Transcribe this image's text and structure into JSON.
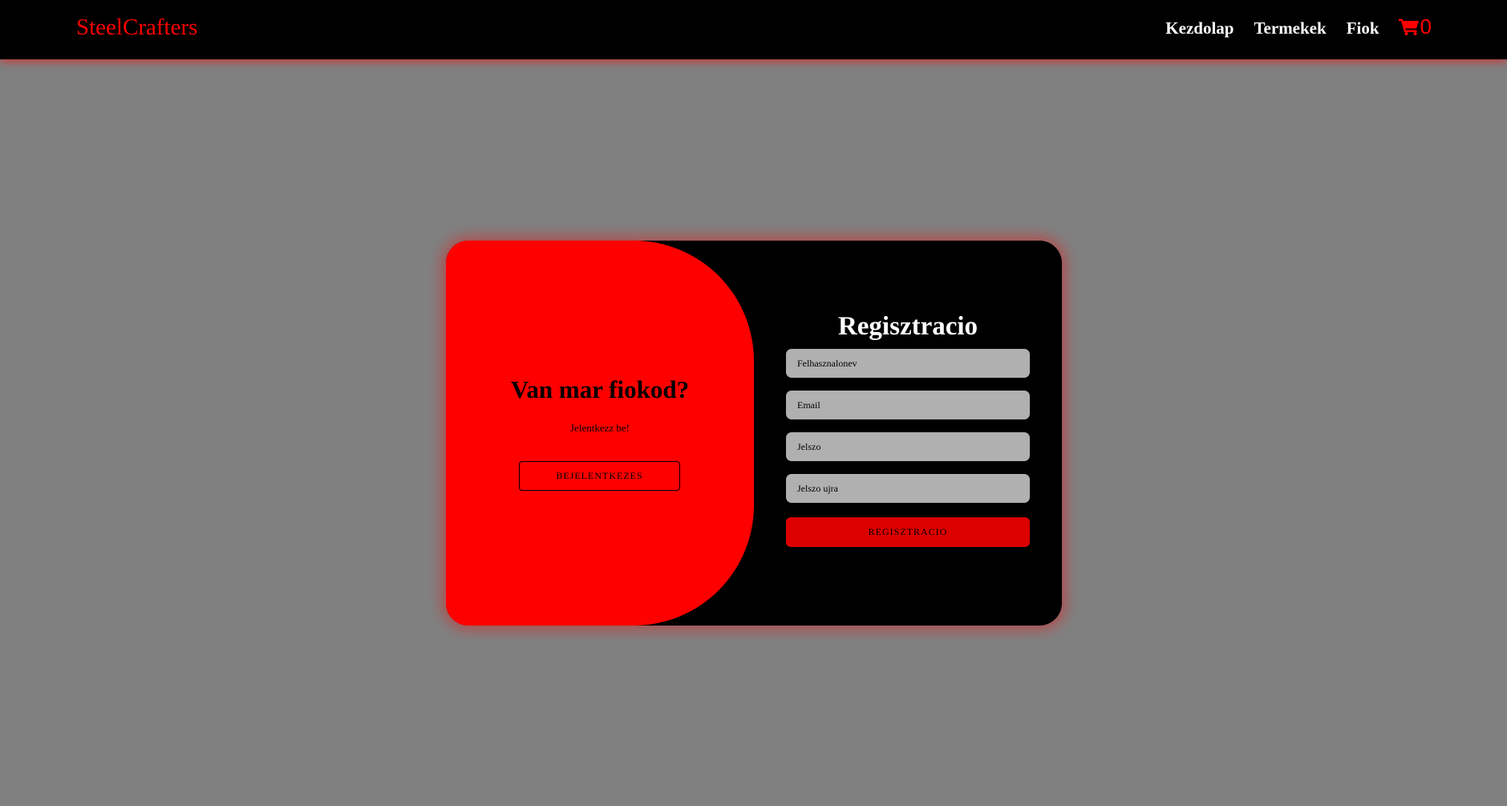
{
  "navbar": {
    "brand": "SteelCrafters",
    "links": [
      "Kezdolap",
      "Termekek",
      "Fiok"
    ],
    "cart_icon": "shopping-cart-icon",
    "cart_count": "0"
  },
  "left_panel": {
    "title": "Van mar fiokod?",
    "subtitle": "Jelentkezz be!",
    "button_label": "BEJELENTKEZES"
  },
  "register_form": {
    "title": "Regisztracio",
    "fields": {
      "username": {
        "placeholder": "Felhasznalonev",
        "value": ""
      },
      "email": {
        "placeholder": "Email",
        "value": ""
      },
      "password": {
        "placeholder": "Jelszo",
        "value": ""
      },
      "password_again": {
        "placeholder": "Jelszo ujra",
        "value": ""
      }
    },
    "submit_label": "REGISZTRACIO"
  },
  "colors": {
    "accent": "#ff0000",
    "background": "#808080",
    "navbar": "#000000",
    "card": "#000000",
    "input": "#b0b0b0",
    "button": "#dd0000"
  }
}
